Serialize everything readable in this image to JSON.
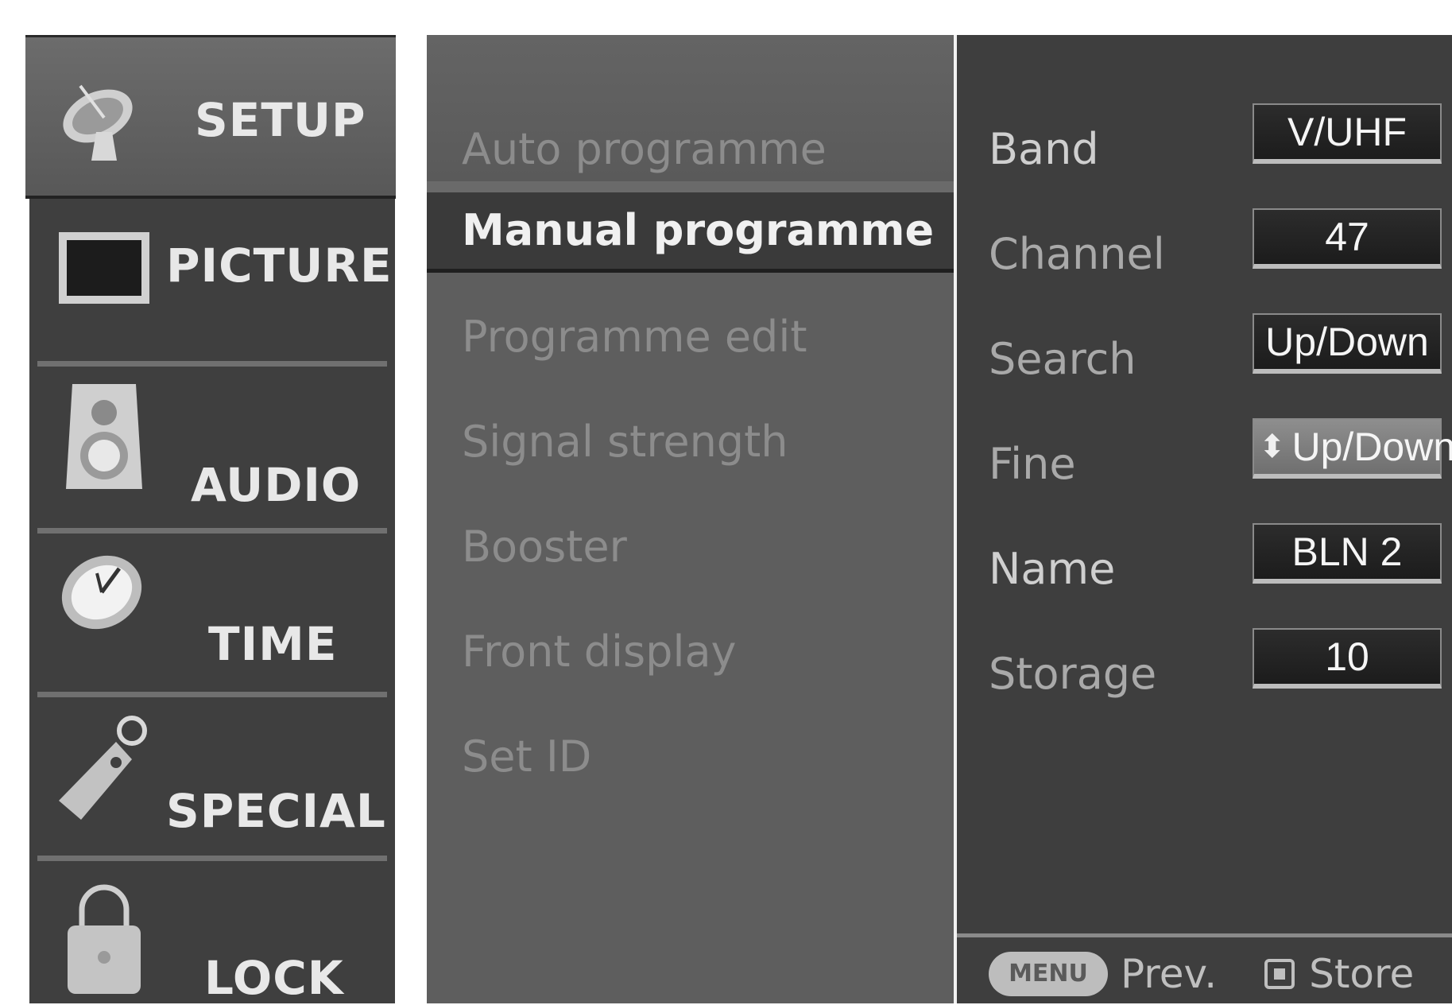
{
  "categories": [
    {
      "label": "SETUP",
      "icon": "satellite-dish-icon",
      "selected": true
    },
    {
      "label": "PICTURE",
      "icon": "picture-icon",
      "selected": false
    },
    {
      "label": "AUDIO",
      "icon": "speaker-icon",
      "selected": false
    },
    {
      "label": "TIME",
      "icon": "clock-icon",
      "selected": false
    },
    {
      "label": "SPECIAL",
      "icon": "key-tag-icon",
      "selected": false
    },
    {
      "label": "LOCK",
      "icon": "padlock-icon",
      "selected": false
    }
  ],
  "menu": {
    "items": [
      "Auto programme",
      "Manual programme",
      "Programme edit",
      "Signal strength",
      "Booster",
      "Front display",
      "Set ID"
    ],
    "selected_index": 1
  },
  "settings": {
    "rows": [
      {
        "label": "Band",
        "value": "V/UHF"
      },
      {
        "label": "Channel",
        "value": "47"
      },
      {
        "label": "Search",
        "value": "Up/Down"
      },
      {
        "label": "Fine",
        "value": "Up/Down",
        "highlighted": true
      },
      {
        "label": "Name",
        "value": "BLN 2"
      },
      {
        "label": "Storage",
        "value": "10"
      }
    ]
  },
  "footer": {
    "menu_key": "MENU",
    "prev_label": "Prev.",
    "store_label": "Store"
  },
  "colors": {
    "category_bg": "#3f3f3f",
    "menu_bg": "#5e5e5e",
    "settings_bg": "#3e3e3e",
    "selected_row": "#3a3a3a",
    "highlight_value": "#7e7e7e"
  }
}
